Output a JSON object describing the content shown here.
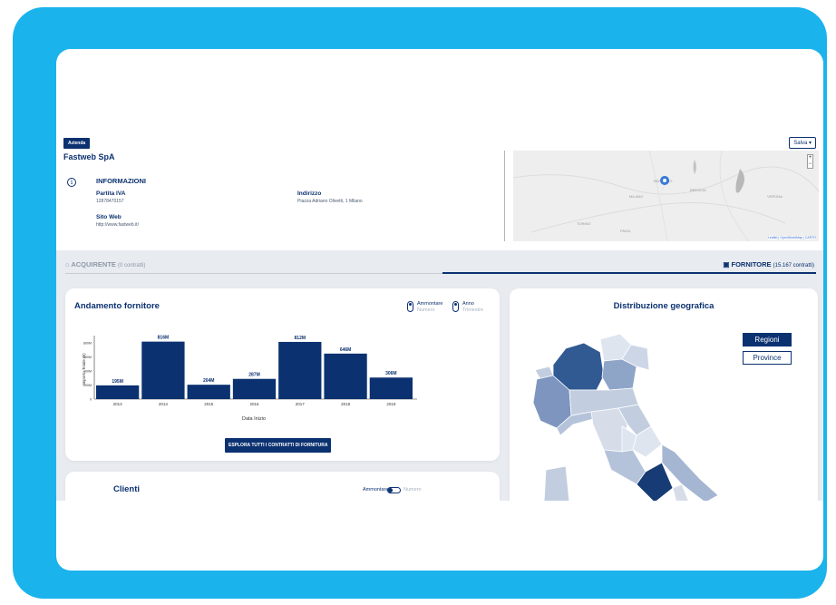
{
  "colors": {
    "frame": "#1bb3ec",
    "brand": "#0b3170",
    "panel": "#e8ebf0"
  },
  "header": {
    "badge": "Azienda",
    "save_label": "Salva",
    "company_name": "Fastweb SpA"
  },
  "info": {
    "title": "INFORMAZIONI",
    "piva_label": "Partita IVA",
    "piva_value": "12878470157",
    "address_label": "Indirizzo",
    "address_value": "Piazza Adriano Olivetti, 1 Milano",
    "web_label": "Sito Web",
    "web_value": "http://www.fastweb.it/"
  },
  "map_thumb": {
    "attribution": "Leaflet | OpenStreetMap | CARTO",
    "places": [
      "BERGAMO",
      "MILANO",
      "BRESCIA",
      "VERONA",
      "TORINO",
      "PAVIA"
    ],
    "zoom_in": "+",
    "zoom_out": "−"
  },
  "tabs": {
    "buyer_label": "ACQUIRENTE",
    "buyer_count": "(0 contratti)",
    "supplier_label": "FORNITORE",
    "supplier_count": "(15.167 contratti)"
  },
  "trend": {
    "title": "Andamento fornitore",
    "toggle1_on": "Ammontare",
    "toggle1_off": "Numero",
    "toggle2_on": "Anno",
    "toggle2_off": "Trimestre",
    "button_label": "ESPLORA TUTTI I CONTRATTI DI FORNITURA"
  },
  "chart_data": {
    "type": "bar",
    "categories": [
      "2013",
      "2014",
      "2015",
      "2016",
      "2017",
      "2018",
      "2019"
    ],
    "values": [
      195,
      816,
      204,
      287,
      812,
      646,
      306
    ],
    "data_labels": [
      "195M",
      "816M",
      "204M",
      "287M",
      "812M",
      "646M",
      "306M"
    ],
    "ylabel": "Importo Totale (€)",
    "xlabel": "Data Inizio",
    "y_ticks": [
      "800M",
      "600M",
      "400M",
      "200M",
      "0"
    ],
    "ylim": [
      0,
      850
    ],
    "color": "#0b3170"
  },
  "geo": {
    "title": "Distribuzione geografica",
    "regions_label": "Regioni",
    "provinces_label": "Province"
  },
  "clients": {
    "title": "Clienti",
    "toggle_on": "Ammontare",
    "toggle_off": "Numero"
  }
}
